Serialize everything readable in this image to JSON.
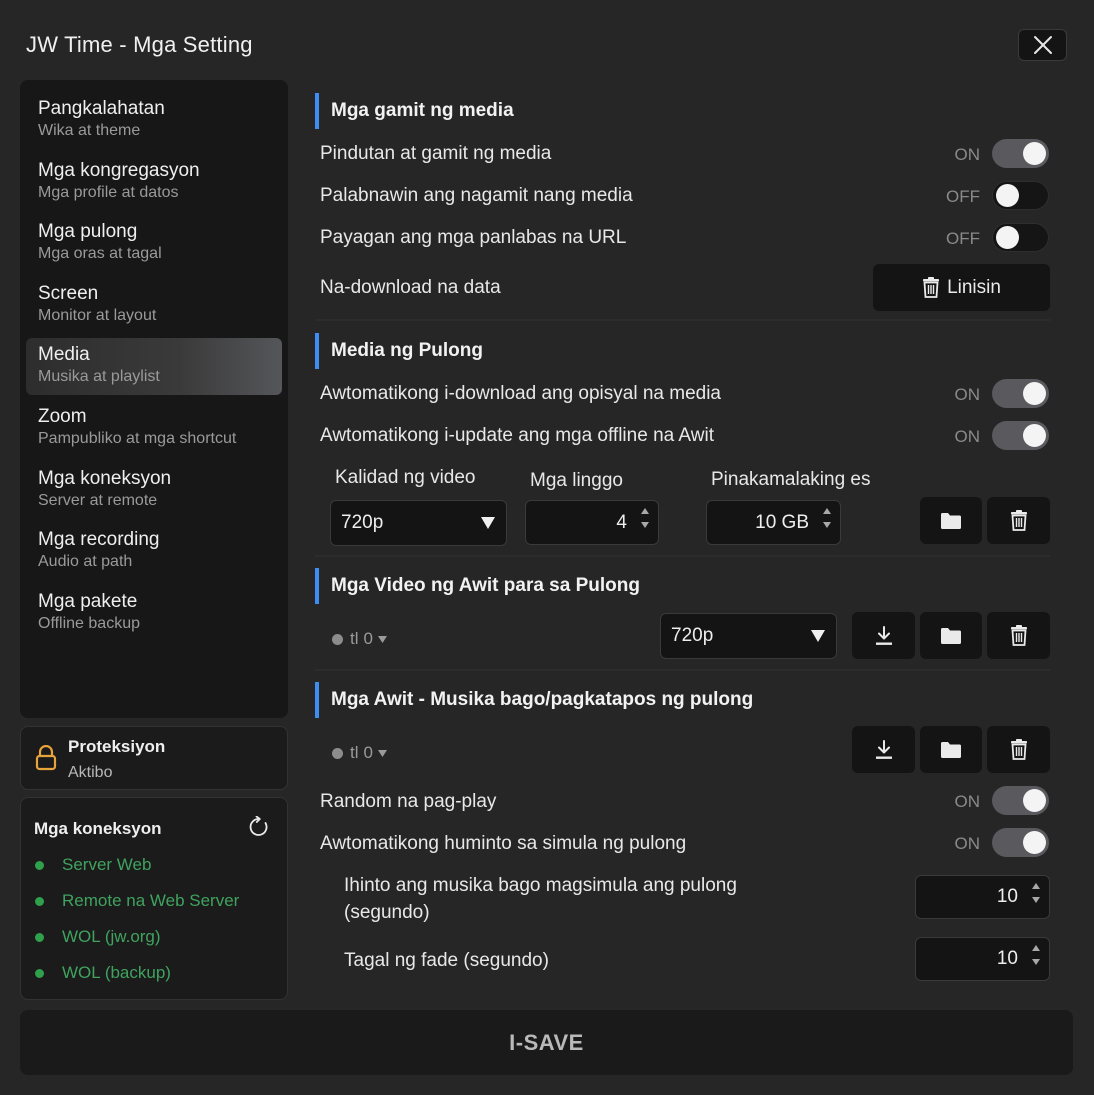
{
  "window": {
    "title": "JW Time - Mga Setting"
  },
  "sidebar": {
    "items": [
      {
        "title": "Pangkalahatan",
        "subtitle": "Wika at theme"
      },
      {
        "title": "Mga kongregasyon",
        "subtitle": "Mga profile at datos"
      },
      {
        "title": "Mga pulong",
        "subtitle": "Mga oras at tagal"
      },
      {
        "title": "Screen",
        "subtitle": "Monitor at layout"
      },
      {
        "title": "Media",
        "subtitle": "Musika at playlist"
      },
      {
        "title": "Zoom",
        "subtitle": "Pampubliko at mga shortcut"
      },
      {
        "title": "Mga koneksyon",
        "subtitle": "Server at remote"
      },
      {
        "title": "Mga recording",
        "subtitle": "Audio at path"
      },
      {
        "title": "Mga pakete",
        "subtitle": "Offline backup"
      }
    ],
    "active_index": 4
  },
  "protection": {
    "title": "Proteksiyon",
    "status": "Aktibo"
  },
  "connections": {
    "title": "Mga koneksyon",
    "items": [
      "Server Web",
      "Remote na Web Server",
      "WOL (jw.org)",
      "WOL (backup)"
    ],
    "status_color": "#2fa14c"
  },
  "media_usage": {
    "title": "Mga gamit ng media",
    "press_use": {
      "label": "Pindutan at gamit ng media",
      "state": "ON"
    },
    "fade_used": {
      "label": "Palabnawin ang nagamit nang media",
      "state": "OFF"
    },
    "external_urls": {
      "label": "Payagan ang mga panlabas na URL",
      "state": "OFF"
    },
    "downloaded": {
      "label": "Na-download na data",
      "clear_label": "Linisin"
    }
  },
  "meeting_media": {
    "title": "Media ng Pulong",
    "auto_download": {
      "label": "Awtomatikong i-download ang opisyal na media",
      "state": "ON"
    },
    "auto_update": {
      "label": "Awtomatikong i-update ang mga offline na Awit",
      "state": "ON"
    },
    "quality": {
      "label": "Kalidad ng video",
      "value": "720p"
    },
    "weeks": {
      "label": "Mga linggo",
      "value": "4"
    },
    "max_size": {
      "label": "Pinakamalaking es",
      "value": "10 GB"
    }
  },
  "song_videos": {
    "title": "Mga Video ng Awit para sa Pulong",
    "language": "tl",
    "count": "0",
    "quality": "720p"
  },
  "songs_music": {
    "title": "Mga Awit - Musika bago/pagkatapos ng pulong",
    "language": "tl",
    "count": "0",
    "random": {
      "label": "Random na pag-play",
      "state": "ON"
    },
    "auto_stop": {
      "label": "Awtomatikong huminto sa simula ng pulong",
      "state": "ON"
    },
    "stop_before_line1": "Ihinto ang musika bago magsimula ang pulong",
    "stop_before_line2": "(segundo)",
    "stop_before_value": "10",
    "fade_label": "Tagal ng fade (segundo)",
    "fade_value": "10"
  },
  "footer": {
    "save_label": "I-SAVE"
  },
  "colors": {
    "accent": "#3d8ef0",
    "background": "#262626",
    "panel": "#171717"
  }
}
